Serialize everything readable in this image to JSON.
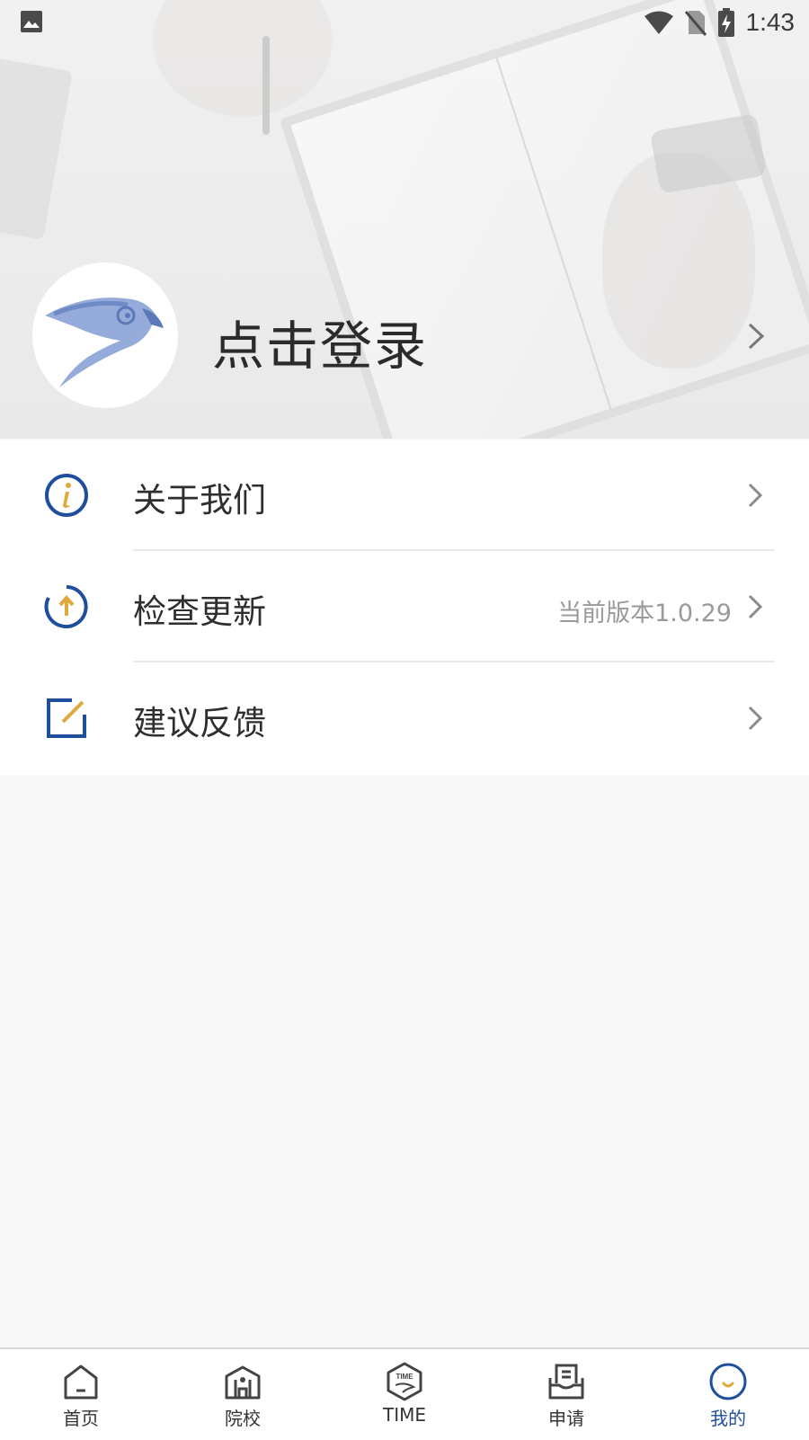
{
  "status_bar": {
    "time": "1:43"
  },
  "profile": {
    "login_label": "点击登录"
  },
  "menu": {
    "items": [
      {
        "label": "关于我们",
        "value": "",
        "icon": "info-icon"
      },
      {
        "label": "检查更新",
        "value": "当前版本1.0.29",
        "icon": "update-icon"
      },
      {
        "label": "建议反馈",
        "value": "",
        "icon": "edit-icon"
      }
    ]
  },
  "tabbar": {
    "tabs": [
      {
        "label": "首页",
        "icon": "home-icon",
        "active": false
      },
      {
        "label": "院校",
        "icon": "school-icon",
        "active": false
      },
      {
        "label": "TIME",
        "icon": "time-badge-icon",
        "active": false
      },
      {
        "label": "申请",
        "icon": "inbox-icon",
        "active": false
      },
      {
        "label": "我的",
        "icon": "profile-smile-icon",
        "active": true
      }
    ]
  },
  "colors": {
    "accent": "#1f4f9c",
    "icon_gold": "#e0a93c",
    "text_primary": "#2e2e2e",
    "text_secondary": "#9a9a9a"
  }
}
